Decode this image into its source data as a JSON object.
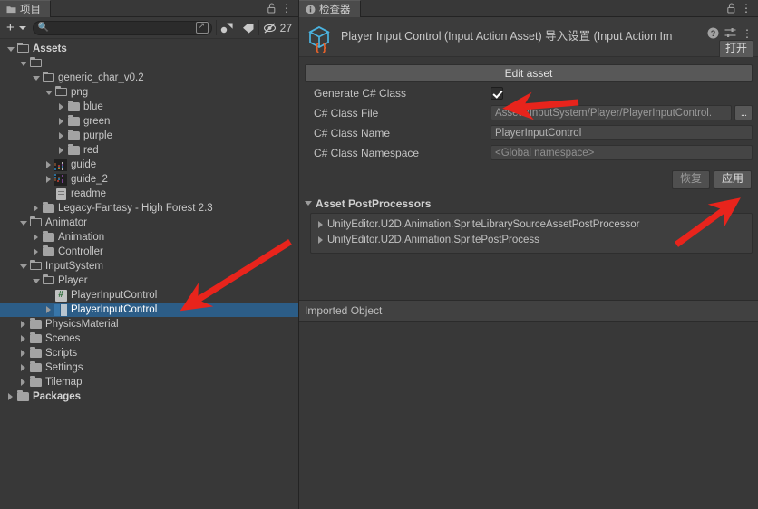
{
  "project_panel": {
    "tab_label": "项目",
    "tab_icon": "folder-icon",
    "lock_icon": "lock-open-icon",
    "menu_icon": "kebab-menu-icon",
    "toolbar": {
      "add_label": "+",
      "search_placeholder": "",
      "search_value": "",
      "search_icon": "search-icon",
      "save_search_icon": "save-search-icon",
      "type_filter_icon": "type-filter-icon",
      "label_filter_icon": "label-tag-icon",
      "hidden_icon": "eye-crossed-icon",
      "hidden_count": "27"
    },
    "tree": [
      {
        "label": "Assets",
        "depth": 0,
        "icon": "folder-open-icon",
        "state": "open",
        "bold": true,
        "selected": false
      },
      {
        "label": "",
        "depth": 1,
        "icon": "folder-open-icon",
        "state": "open",
        "bold": false,
        "selected": false
      },
      {
        "label": "generic_char_v0.2",
        "depth": 2,
        "icon": "folder-open-icon",
        "state": "open",
        "bold": false,
        "selected": false
      },
      {
        "label": "png",
        "depth": 3,
        "icon": "folder-open-icon",
        "state": "open",
        "bold": false,
        "selected": false
      },
      {
        "label": "blue",
        "depth": 4,
        "icon": "folder-closed-icon",
        "state": "closed",
        "bold": false,
        "selected": false
      },
      {
        "label": "green",
        "depth": 4,
        "icon": "folder-closed-icon",
        "state": "closed",
        "bold": false,
        "selected": false
      },
      {
        "label": "purple",
        "depth": 4,
        "icon": "folder-closed-icon",
        "state": "closed",
        "bold": false,
        "selected": false
      },
      {
        "label": "red",
        "depth": 4,
        "icon": "folder-closed-icon",
        "state": "closed",
        "bold": false,
        "selected": false
      },
      {
        "label": "guide",
        "depth": 3,
        "icon": "sprite-thumbnail-icon",
        "state": "closed",
        "bold": false,
        "selected": false
      },
      {
        "label": "guide_2",
        "depth": 3,
        "icon": "sprite-thumbnail-icon",
        "state": "closed",
        "bold": false,
        "selected": false
      },
      {
        "label": "readme",
        "depth": 3,
        "icon": "text-document-icon",
        "state": "leaf",
        "bold": false,
        "selected": false
      },
      {
        "label": "Legacy-Fantasy - High Forest 2.3",
        "depth": 2,
        "icon": "folder-closed-icon",
        "state": "closed",
        "bold": false,
        "selected": false
      },
      {
        "label": "Animator",
        "depth": 1,
        "icon": "folder-open-icon",
        "state": "open",
        "bold": false,
        "selected": false
      },
      {
        "label": "Animation",
        "depth": 2,
        "icon": "folder-closed-icon",
        "state": "closed",
        "bold": false,
        "selected": false
      },
      {
        "label": "Controller",
        "depth": 2,
        "icon": "folder-closed-icon",
        "state": "closed",
        "bold": false,
        "selected": false
      },
      {
        "label": "InputSystem",
        "depth": 1,
        "icon": "folder-open-icon",
        "state": "open",
        "bold": false,
        "selected": false
      },
      {
        "label": "Player",
        "depth": 2,
        "icon": "folder-open-icon",
        "state": "open",
        "bold": false,
        "selected": false
      },
      {
        "label": "PlayerInputControl",
        "depth": 3,
        "icon": "csharp-script-icon",
        "state": "leaf",
        "bold": false,
        "selected": false
      },
      {
        "label": "PlayerInputControl",
        "depth": 3,
        "icon": "input-action-asset-icon",
        "state": "closed",
        "bold": false,
        "selected": true
      },
      {
        "label": "PhysicsMaterial",
        "depth": 1,
        "icon": "folder-closed-icon",
        "state": "closed",
        "bold": false,
        "selected": false
      },
      {
        "label": "Scenes",
        "depth": 1,
        "icon": "folder-closed-icon",
        "state": "closed",
        "bold": false,
        "selected": false
      },
      {
        "label": "Scripts",
        "depth": 1,
        "icon": "folder-closed-icon",
        "state": "closed",
        "bold": false,
        "selected": false
      },
      {
        "label": "Settings",
        "depth": 1,
        "icon": "folder-closed-icon",
        "state": "closed",
        "bold": false,
        "selected": false
      },
      {
        "label": "Tilemap",
        "depth": 1,
        "icon": "folder-closed-icon",
        "state": "closed",
        "bold": false,
        "selected": false
      },
      {
        "label": "Packages",
        "depth": 0,
        "icon": "folder-closed-icon",
        "state": "closed",
        "bold": true,
        "selected": false
      }
    ]
  },
  "inspector": {
    "tab_label": "检查器",
    "tab_icon": "info-circle-icon",
    "lock_icon": "lock-open-icon",
    "menu_icon": "kebab-menu-icon",
    "asset_icon": "input-action-asset-cube-icon",
    "title": "Player Input Control (Input Action Asset) 导入设置 (Input Action Im",
    "help_icon": "help-circle-icon",
    "preset_icon": "preset-settings-icon",
    "options_icon": "kebab-menu-icon",
    "open_button": "打开",
    "edit_asset_button": "Edit asset",
    "fields": [
      {
        "label": "Generate C# Class",
        "type": "checkbox",
        "value": "",
        "checked": true
      },
      {
        "label": "C# Class File",
        "type": "path",
        "value": "Assets/InputSystem/Player/PlayerInputControl.",
        "browse": "..."
      },
      {
        "label": "C# Class Name",
        "type": "text",
        "value": "PlayerInputControl"
      },
      {
        "label": "C# Class Namespace",
        "type": "text",
        "value": "<Global namespace>"
      }
    ],
    "revert_button": "恢复",
    "apply_button": "应用",
    "postprocessors": {
      "section_title": "Asset PostProcessors",
      "items": [
        "UnityEditor.U2D.Animation.SpriteLibrarySourceAssetPostProcessor",
        "UnityEditor.U2D.Animation.SpritePostProcess"
      ]
    },
    "imported_object_label": "Imported Object"
  },
  "annotations": {
    "arrow_color": "#E8241C",
    "arrows": [
      {
        "name": "arrow-to-tree-selection"
      },
      {
        "name": "arrow-to-generate-checkbox"
      },
      {
        "name": "arrow-to-apply-button"
      }
    ]
  },
  "colors": {
    "panel_bg": "#383838",
    "selection_blue": "#2C5D87",
    "field_bg": "#454545",
    "button_bg": "#585858"
  }
}
